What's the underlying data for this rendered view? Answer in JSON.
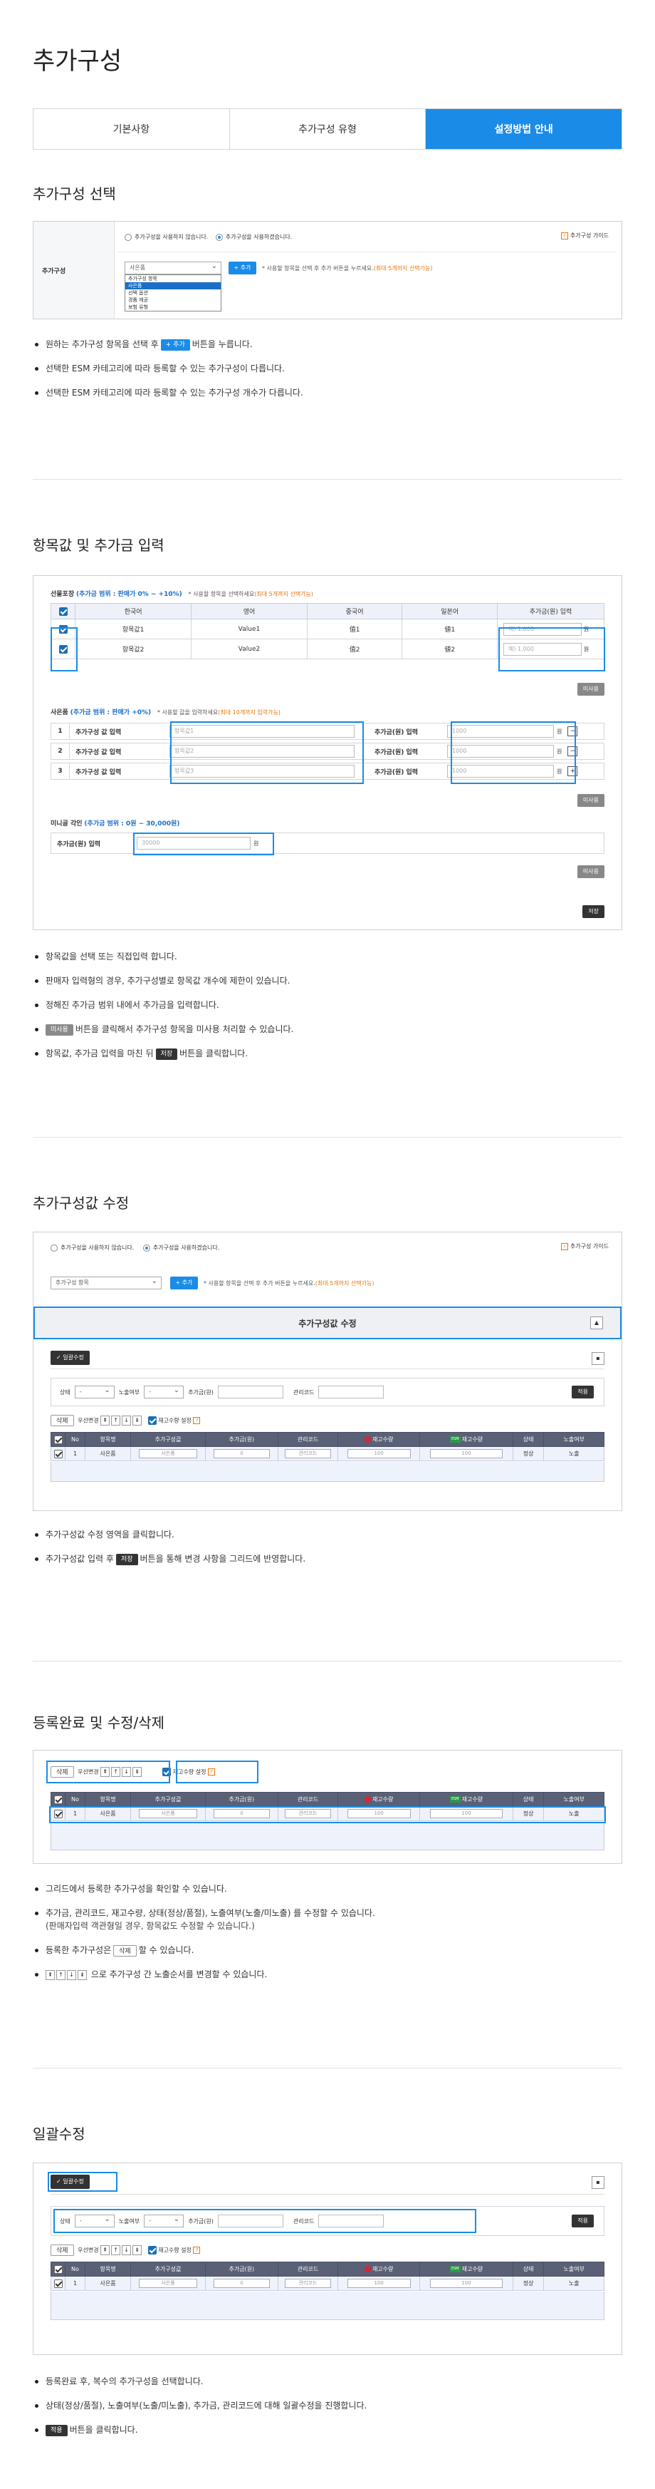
{
  "page_title": "추가구성",
  "tabs": [
    {
      "label": "기본사항",
      "active": false
    },
    {
      "label": "추가구성 유형",
      "active": false
    },
    {
      "label": "설정방법 안내",
      "active": true
    }
  ],
  "colors": {
    "accent": "#1a8ce8",
    "header": "#5a6076",
    "orange": "#e8750a"
  },
  "s1": {
    "title": "추가구성 선택",
    "label": "추가구성",
    "radio_off": "추가구성을 사용하지 않습니다.",
    "radio_on": "추가구성을 사용하겠습니다.",
    "guide": "추가구성 가이드",
    "select_value": "사은품",
    "add_btn": "+ 추가",
    "hint": "* 사용할 항목을 선택 후 추가 버튼을 누르세요.",
    "hint_orange": "(최대 5개까지 선택가능)",
    "options": [
      "추가구성 항목",
      "사은품",
      "선택 옵션",
      "경품 제공",
      "보험 유형"
    ],
    "bullets": {
      "b1_pre": "원하는 추가구성 항목을 선택 후",
      "b1_chip": "+ 추가",
      "b1_post": "버튼을 누릅니다.",
      "b2": "선택한 ESM 카테고리에 따라 등록할 수 있는 추가구성이 다릅니다.",
      "b3": "선택한 ESM 카테고리에 따라 등록할 수 있는 추가구성 개수가 다릅니다."
    }
  },
  "s2": {
    "title": "항목값 및 추가금 입력",
    "blockA_title": "선물포장",
    "blockA_range": "(추가금 범위 : 판매가 0% ~ +10%)",
    "blockA_hint": "* 사용할 항목을 선택하세요",
    "blockA_hint_o": "(최대 5개까지 선택가능)",
    "headers": [
      "한국어",
      "영어",
      "중국어",
      "일본어",
      "추가금(원) 입력"
    ],
    "rows": [
      {
        "ko": "항목값1",
        "en": "Value1",
        "zh": "值1",
        "ja": "値1",
        "price": "예) 1,000",
        "unit": "원"
      },
      {
        "ko": "항목값2",
        "en": "Value2",
        "zh": "值2",
        "ja": "値2",
        "price": "예) 1,000",
        "unit": "원"
      }
    ],
    "misaeyong": "미사용",
    "blockB_title": "사은품",
    "blockB_range": "(추가금 범위 : 판매가 +0%)",
    "blockB_hint": "* 사용할 값을 입력하세요",
    "blockB_hint_o": "(최대 10개까지 입력가능)",
    "b_rows": [
      {
        "n": "1",
        "label": "추가구성 값 입력",
        "ph": "항목값1",
        "plabel": "추가금(원) 입력",
        "pv": "1000",
        "unit": "원",
        "op": "−"
      },
      {
        "n": "2",
        "label": "추가구성 값 입력",
        "ph": "항목값2",
        "plabel": "추가금(원) 입력",
        "pv": "1000",
        "unit": "원",
        "op": "−"
      },
      {
        "n": "3",
        "label": "추가구성 값 입력",
        "ph": "항목값3",
        "plabel": "추가금(원) 입력",
        "pv": "1000",
        "unit": "원",
        "op": "+"
      }
    ],
    "blockC_title": "미니골 각인",
    "blockC_range": "(추가금 범위 : 0원 ~ 30,000원)",
    "c_label": "추가금(원) 입력",
    "c_value": "30000",
    "c_unit": "원",
    "save": "저장",
    "bullets": {
      "b1": "항목값을 선택 또는 직접입력 합니다.",
      "b2": "판매자 입력형의 경우, 추가구성별로 항목값 개수에 제한이 있습니다.",
      "b3": "정해진 추가금 범위 내에서 추가금을 입력합니다.",
      "b4_chip": "미사용",
      "b4_post": "버튼을 클릭해서 추가구성 항목을 미사용 처리할 수 있습니다.",
      "b5_pre": "항목값, 추가금 입력을 마친 뒤",
      "b5_chip": "저장",
      "b5_post": "버튼을 클릭합니다."
    }
  },
  "s3": {
    "title": "추가구성값 수정",
    "radio_off": "추가구성을 사용하지 않습니다.",
    "radio_on": "추가구성을 사용하겠습니다.",
    "guide": "추가구성 가이드",
    "select_value": "추가구성 항목",
    "add_btn": "+ 추가",
    "hint": "* 사용할 항목을 선택 후 추가 버튼을 누르세요.",
    "hint_o": "(최대 5개까지 선택가능)",
    "bar_title": "추가구성값 수정",
    "bar_toggle": "▲",
    "bulk_btn": "✓ 일괄수정",
    "bulk_toggle": "▪",
    "f_state": "상태",
    "f_expose": "노출여부",
    "f_price": "추가금(원)",
    "f_code": "관리코드",
    "f_apply": "적용",
    "del": "삭제",
    "order": "우선변경",
    "stock": "재고수량 설정",
    "stock_q": "?",
    "grid_headers": [
      "No",
      "항목명",
      "추가구성값",
      "추가금(원)",
      "관리코드",
      "재고수량",
      "재고수량",
      "상태",
      "노출여부"
    ],
    "grid_row": {
      "no": "1",
      "name": "사은품",
      "value": "사은품",
      "price": "0",
      "code": "관리코드",
      "s1": "100",
      "s2": "100",
      "state": "정상",
      "expose": "노출"
    },
    "bullets": {
      "b1": "추가구성값 수정 영역을 클릭합니다.",
      "b2_pre": "추가구성값 입력 후",
      "b2_chip": "저장",
      "b2_post": "버튼을 통해 변경 사항을 그리드에 반영합니다."
    }
  },
  "s4": {
    "title": "등록완료 및 수정/삭제",
    "bullets": {
      "b1": "그리드에서 등록한 추가구성을 확인할 수 있습니다.",
      "b2": "추가금, 관리코드, 재고수량, 상태(정상/품절), 노출여부(노출/미노출) 를 수정할 수 있습니다.",
      "b2_sub": "(판매자입력 객관형일 경우, 항목값도 수정할 수 있습니다.)",
      "b3_pre": "등록한 추가구성은",
      "b3_chip": "삭제",
      "b3_post": "할 수 있습니다.",
      "b4_post": "으로 추가구성 간 노출순서를 변경할 수 있습니다."
    }
  },
  "s5": {
    "title": "일괄수정",
    "bullets": {
      "b1": "등록완료 후, 복수의 추가구성을 선택합니다.",
      "b2": "상태(정상/품절), 노출여부(노출/미노출), 추가금, 관리코드에 대해 일괄수정을 진행합니다.",
      "b3_chip": "적용",
      "b3_post": "버튼을 클릭합니다."
    }
  },
  "arrows": [
    "⇞",
    "↑",
    "↓",
    "⇟"
  ]
}
